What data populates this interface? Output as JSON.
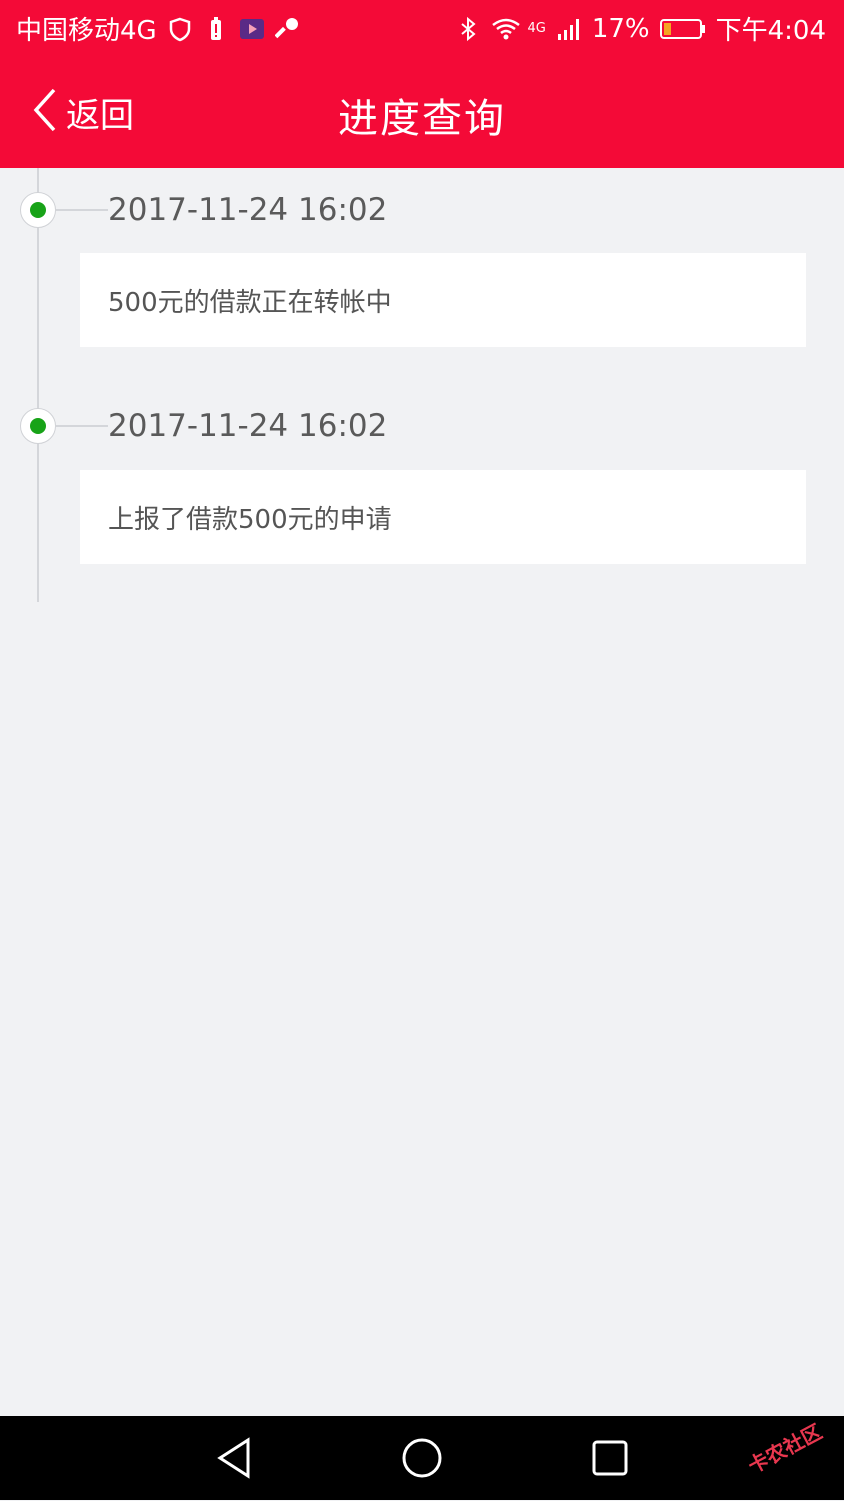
{
  "status_bar": {
    "carrier": "中国移动4G",
    "network": "4G",
    "battery": "17%",
    "time": "下午4:04",
    "icons": [
      "shield-icon",
      "battery-alert-icon",
      "video-app-icon",
      "key-icon",
      "bluetooth-icon",
      "wifi-icon",
      "signal-icon",
      "battery-icon"
    ]
  },
  "header": {
    "back_label": "返回",
    "title": "进度查询"
  },
  "timeline": [
    {
      "datetime": "2017-11-24 16:02",
      "text": "500元的借款正在转帐中"
    },
    {
      "datetime": "2017-11-24 16:02",
      "text": "上报了借款500元的申请"
    }
  ],
  "nav": {
    "icons": [
      "back-triangle-icon",
      "home-circle-icon",
      "recents-square-icon"
    ]
  },
  "watermark": {
    "text": "卡农社区"
  },
  "colors": {
    "brand": "#f40a37",
    "background": "#f1f2f4",
    "dot": "#18a318"
  }
}
